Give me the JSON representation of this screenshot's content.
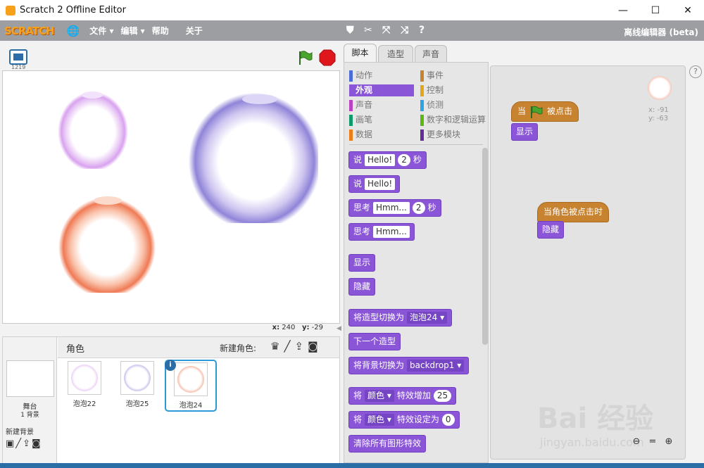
{
  "window": {
    "title": "Scratch 2 Offline Editor",
    "minimize": "—",
    "maximize": "☐",
    "close": "✕"
  },
  "menu": {
    "logo": "SCRATCH",
    "file": "文件 ▾",
    "edit": "编辑 ▾",
    "help": "帮助",
    "about": "关于",
    "edition": "离线编辑器 (beta)"
  },
  "stage": {
    "version": "1219",
    "coords_x_label": "x:",
    "coords_x": "240",
    "coords_y_label": "y:",
    "coords_y": "-29"
  },
  "sprites_pane": {
    "title": "角色",
    "new_sprite_label": "新建角色:",
    "stage_label": "舞台",
    "stage_count": "1 背景",
    "new_backdrop_label": "新建背景",
    "sprites": [
      {
        "name": "泡泡22",
        "color": "#c98de0"
      },
      {
        "name": "泡泡25",
        "color": "#8a7fd9"
      },
      {
        "name": "泡泡24",
        "color": "#f07a55"
      }
    ]
  },
  "tabs": [
    "脚本",
    "造型",
    "声音"
  ],
  "categories": [
    {
      "label": "动作",
      "color": "#4a6cd4"
    },
    {
      "label": "外观",
      "color": "#8a55d7"
    },
    {
      "label": "声音",
      "color": "#bb42c3"
    },
    {
      "label": "画笔",
      "color": "#0e9a6c"
    },
    {
      "label": "数据",
      "color": "#ee7d16"
    },
    {
      "label": "事件",
      "color": "#c88330"
    },
    {
      "label": "控制",
      "color": "#e1a91a"
    },
    {
      "label": "侦测",
      "color": "#2ca5e2"
    },
    {
      "label": "数字和逻辑运算",
      "color": "#5cb712"
    },
    {
      "label": "更多模块",
      "color": "#632d99"
    }
  ],
  "blocks": {
    "say_secs": {
      "verb": "说",
      "text": "Hello!",
      "num": "2",
      "unit": "秒"
    },
    "say": {
      "verb": "说",
      "text": "Hello!"
    },
    "think_secs": {
      "verb": "思考",
      "text": "Hmm...",
      "num": "2",
      "unit": "秒"
    },
    "think": {
      "verb": "思考",
      "text": "Hmm..."
    },
    "show": "显示",
    "hide": "隐藏",
    "switch_costume": {
      "label": "将造型切换为",
      "value": "泡泡24 ▾"
    },
    "next_costume": "下一个造型",
    "switch_backdrop": {
      "label": "将背景切换为",
      "value": "backdrop1 ▾"
    },
    "change_effect": {
      "pre": "将",
      "effect": "颜色 ▾",
      "post": "特效增加",
      "num": "25"
    },
    "set_effect": {
      "pre": "将",
      "effect": "颜色 ▾",
      "post": "特效设定为",
      "num": "0"
    },
    "clear_effects": "清除所有图形特效"
  },
  "scripts": {
    "flag_hat": {
      "pre": "当",
      "post": "被点击"
    },
    "flag_show": "显示",
    "sprite_hat": "当角色被点击时",
    "sprite_hide": "隐藏",
    "sprite_x": "x: -91",
    "sprite_y": "y: -63"
  },
  "watermark": {
    "brand": "Bai 经验",
    "url": "jingyan.baidu.com"
  }
}
